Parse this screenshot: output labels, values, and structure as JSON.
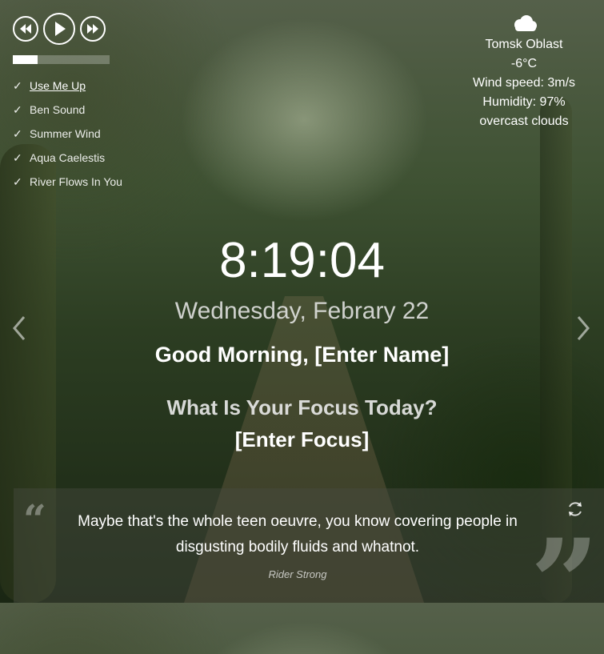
{
  "player": {
    "buttons": {
      "prev": "rewind-icon",
      "play": "play-icon",
      "next": "fast-forward-icon"
    },
    "progress": 0.26,
    "tracks": [
      {
        "title": "Use Me Up",
        "active": true
      },
      {
        "title": "Ben Sound",
        "active": false
      },
      {
        "title": "Summer Wind",
        "active": false
      },
      {
        "title": "Aqua Caelestis",
        "active": false
      },
      {
        "title": "River Flows In You",
        "active": false
      }
    ],
    "check_glyph": "✓"
  },
  "weather": {
    "icon": "cloud-icon",
    "location": "Tomsk Oblast",
    "temperature": "-6°C",
    "wind": "Wind speed: 3m/s",
    "humidity": "Humidity: 97%",
    "description": "overcast clouds"
  },
  "clock": {
    "time": "8:19:04",
    "date": "Wednesday, Febrary 22"
  },
  "greeting": {
    "text": "Good Morning, [Enter Name]"
  },
  "focus": {
    "question": "What Is Your Focus Today?",
    "input": "[Enter Focus]"
  },
  "navigation": {
    "prev": "chevron-left-icon",
    "next": "chevron-right-icon"
  },
  "quote": {
    "text": "Maybe that's the whole teen oeuvre, you know covering people in disgusting bodily fluids and whatnot.",
    "author": "Rider Strong",
    "open_mark": "“",
    "close_mark": "”",
    "refresh_icon": "refresh-icon"
  }
}
